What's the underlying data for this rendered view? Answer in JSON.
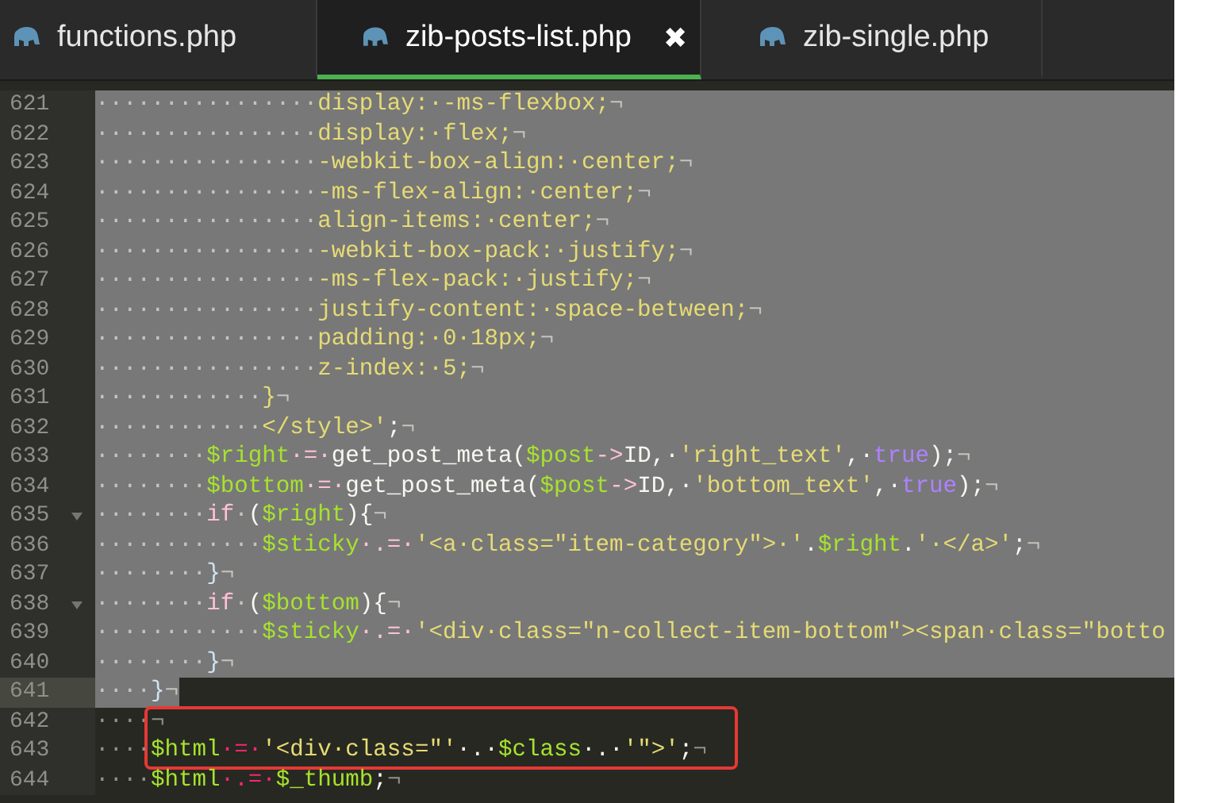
{
  "tabs": [
    {
      "label": "functions.php",
      "selected": false
    },
    {
      "label": "zib-posts-list.php",
      "selected": true,
      "close": "✖"
    },
    {
      "label": "zib-single.php",
      "selected": false
    }
  ],
  "editor": {
    "lines": [
      {
        "number": "621",
        "kind": "selected",
        "fold": false,
        "current": false,
        "segments": [
          {
            "text": "················",
            "kind": "ws"
          },
          {
            "text": "display:·-ms-flexbox;",
            "kind": "str"
          },
          {
            "text": "¬",
            "kind": "ws"
          }
        ]
      },
      {
        "number": "622",
        "kind": "selected",
        "fold": false,
        "current": false,
        "segments": [
          {
            "text": "················",
            "kind": "ws"
          },
          {
            "text": "display:·flex;",
            "kind": "str"
          },
          {
            "text": "¬",
            "kind": "ws"
          }
        ]
      },
      {
        "number": "623",
        "kind": "selected",
        "fold": false,
        "current": false,
        "segments": [
          {
            "text": "················",
            "kind": "ws"
          },
          {
            "text": "-webkit-box-align:·center;",
            "kind": "str"
          },
          {
            "text": "¬",
            "kind": "ws"
          }
        ]
      },
      {
        "number": "624",
        "kind": "selected",
        "fold": false,
        "current": false,
        "segments": [
          {
            "text": "················",
            "kind": "ws"
          },
          {
            "text": "-ms-flex-align:·center;",
            "kind": "str"
          },
          {
            "text": "¬",
            "kind": "ws"
          }
        ]
      },
      {
        "number": "625",
        "kind": "selected",
        "fold": false,
        "current": false,
        "segments": [
          {
            "text": "················",
            "kind": "ws"
          },
          {
            "text": "align-items:·center;",
            "kind": "str"
          },
          {
            "text": "¬",
            "kind": "ws"
          }
        ]
      },
      {
        "number": "626",
        "kind": "selected",
        "fold": false,
        "current": false,
        "segments": [
          {
            "text": "················",
            "kind": "ws"
          },
          {
            "text": "-webkit-box-pack:·justify;",
            "kind": "str"
          },
          {
            "text": "¬",
            "kind": "ws"
          }
        ]
      },
      {
        "number": "627",
        "kind": "selected",
        "fold": false,
        "current": false,
        "segments": [
          {
            "text": "················",
            "kind": "ws"
          },
          {
            "text": "-ms-flex-pack:·justify;",
            "kind": "str"
          },
          {
            "text": "¬",
            "kind": "ws"
          }
        ]
      },
      {
        "number": "628",
        "kind": "selected",
        "fold": false,
        "current": false,
        "segments": [
          {
            "text": "················",
            "kind": "ws"
          },
          {
            "text": "justify-content:·space-between;",
            "kind": "str"
          },
          {
            "text": "¬",
            "kind": "ws"
          }
        ]
      },
      {
        "number": "629",
        "kind": "selected",
        "fold": false,
        "current": false,
        "segments": [
          {
            "text": "················",
            "kind": "ws"
          },
          {
            "text": "padding:·0·18px;",
            "kind": "str"
          },
          {
            "text": "¬",
            "kind": "ws"
          }
        ]
      },
      {
        "number": "630",
        "kind": "selected",
        "fold": false,
        "current": false,
        "segments": [
          {
            "text": "················",
            "kind": "ws"
          },
          {
            "text": "z-index:·5;",
            "kind": "str"
          },
          {
            "text": "¬",
            "kind": "ws"
          }
        ]
      },
      {
        "number": "631",
        "kind": "selected",
        "fold": false,
        "current": false,
        "segments": [
          {
            "text": "············",
            "kind": "ws"
          },
          {
            "text": "}",
            "kind": "str"
          },
          {
            "text": "¬",
            "kind": "ws"
          }
        ]
      },
      {
        "number": "632",
        "kind": "selected",
        "fold": false,
        "current": false,
        "segments": [
          {
            "text": "············",
            "kind": "ws"
          },
          {
            "text": "</style>'",
            "kind": "str"
          },
          {
            "text": ";",
            "kind": "plain"
          },
          {
            "text": "¬",
            "kind": "ws"
          }
        ]
      },
      {
        "number": "633",
        "kind": "selected",
        "fold": false,
        "current": false,
        "segments": [
          {
            "text": "········",
            "kind": "ws"
          },
          {
            "text": "$right",
            "kind": "var"
          },
          {
            "text": "·=·",
            "kind": "op"
          },
          {
            "text": "get_post_meta(",
            "kind": "plain"
          },
          {
            "text": "$post",
            "kind": "var"
          },
          {
            "text": "->",
            "kind": "op"
          },
          {
            "text": "ID,·",
            "kind": "plain"
          },
          {
            "text": "'right_text'",
            "kind": "str"
          },
          {
            "text": ",·",
            "kind": "plain"
          },
          {
            "text": "true",
            "kind": "const"
          },
          {
            "text": ");",
            "kind": "plain"
          },
          {
            "text": "¬",
            "kind": "ws"
          }
        ]
      },
      {
        "number": "634",
        "kind": "selected",
        "fold": false,
        "current": false,
        "segments": [
          {
            "text": "········",
            "kind": "ws"
          },
          {
            "text": "$bottom",
            "kind": "var"
          },
          {
            "text": "·=·",
            "kind": "op"
          },
          {
            "text": "get_post_meta(",
            "kind": "plain"
          },
          {
            "text": "$post",
            "kind": "var"
          },
          {
            "text": "->",
            "kind": "op"
          },
          {
            "text": "ID,·",
            "kind": "plain"
          },
          {
            "text": "'bottom_text'",
            "kind": "str"
          },
          {
            "text": ",·",
            "kind": "plain"
          },
          {
            "text": "true",
            "kind": "const"
          },
          {
            "text": ");",
            "kind": "plain"
          },
          {
            "text": "¬",
            "kind": "ws"
          }
        ]
      },
      {
        "number": "635",
        "kind": "selected",
        "fold": true,
        "current": false,
        "segments": [
          {
            "text": "········",
            "kind": "ws"
          },
          {
            "text": "if",
            "kind": "op"
          },
          {
            "text": "·",
            "kind": "ws"
          },
          {
            "text": "(",
            "kind": "plain"
          },
          {
            "text": "$right",
            "kind": "var"
          },
          {
            "text": "){",
            "kind": "plain"
          },
          {
            "text": "¬",
            "kind": "ws"
          }
        ]
      },
      {
        "number": "636",
        "kind": "selected",
        "fold": false,
        "current": false,
        "segments": [
          {
            "text": "············",
            "kind": "ws"
          },
          {
            "text": "$sticky",
            "kind": "var"
          },
          {
            "text": "·.=·",
            "kind": "op"
          },
          {
            "text": "'<a·class=\"item-category\">·'",
            "kind": "str"
          },
          {
            "text": ".",
            "kind": "plain"
          },
          {
            "text": "$right",
            "kind": "var"
          },
          {
            "text": ".",
            "kind": "plain"
          },
          {
            "text": "'·</a>'",
            "kind": "str"
          },
          {
            "text": ";",
            "kind": "plain"
          },
          {
            "text": "¬",
            "kind": "ws"
          }
        ]
      },
      {
        "number": "637",
        "kind": "selected",
        "fold": false,
        "current": false,
        "segments": [
          {
            "text": "········",
            "kind": "ws"
          },
          {
            "text": "}",
            "kind": "brace"
          },
          {
            "text": "¬",
            "kind": "ws"
          }
        ]
      },
      {
        "number": "638",
        "kind": "selected",
        "fold": true,
        "current": false,
        "segments": [
          {
            "text": "········",
            "kind": "ws"
          },
          {
            "text": "if",
            "kind": "op"
          },
          {
            "text": "·",
            "kind": "ws"
          },
          {
            "text": "(",
            "kind": "plain"
          },
          {
            "text": "$bottom",
            "kind": "var"
          },
          {
            "text": "){",
            "kind": "plain"
          },
          {
            "text": "¬",
            "kind": "ws"
          }
        ]
      },
      {
        "number": "639",
        "kind": "selected",
        "fold": false,
        "current": false,
        "segments": [
          {
            "text": "············",
            "kind": "ws"
          },
          {
            "text": "$sticky",
            "kind": "var"
          },
          {
            "text": "·.=·",
            "kind": "op"
          },
          {
            "text": "'<div·class=\"n-collect-item-bottom\"><span·class=\"botto",
            "kind": "str"
          }
        ]
      },
      {
        "number": "640",
        "kind": "selected",
        "fold": false,
        "current": false,
        "segments": [
          {
            "text": "········",
            "kind": "ws"
          },
          {
            "text": "}",
            "kind": "brace"
          },
          {
            "text": "¬",
            "kind": "ws"
          }
        ]
      },
      {
        "number": "641",
        "kind": "partial",
        "fold": false,
        "current": true,
        "segments": [
          {
            "text": "····",
            "kind": "ws"
          },
          {
            "text": "}",
            "kind": "brace"
          },
          {
            "text": "¬",
            "kind": "ws"
          }
        ]
      },
      {
        "number": "642",
        "kind": "plain",
        "fold": false,
        "current": false,
        "boxed": true,
        "segments": [
          {
            "text": "····¬",
            "kind": "ws"
          }
        ]
      },
      {
        "number": "643",
        "kind": "plain",
        "fold": false,
        "current": false,
        "boxed": true,
        "segments": [
          {
            "text": "····",
            "kind": "ws"
          },
          {
            "text": "$html",
            "kind": "var"
          },
          {
            "text": "·=·",
            "kind": "op"
          },
          {
            "text": "'<div·class=\"'",
            "kind": "str"
          },
          {
            "text": "·.·",
            "kind": "plain"
          },
          {
            "text": "$class",
            "kind": "var"
          },
          {
            "text": "·.·",
            "kind": "plain"
          },
          {
            "text": "'\">'",
            "kind": "str"
          },
          {
            "text": ";",
            "kind": "plain"
          },
          {
            "text": "¬",
            "kind": "ws"
          }
        ]
      },
      {
        "number": "644",
        "kind": "plain",
        "fold": false,
        "current": false,
        "boxed": false,
        "segments": [
          {
            "text": "····",
            "kind": "ws"
          },
          {
            "text": "$html",
            "kind": "var"
          },
          {
            "text": "·.=·",
            "kind": "op"
          },
          {
            "text": "$_thumb",
            "kind": "var"
          },
          {
            "text": ";",
            "kind": "plain"
          },
          {
            "text": "¬",
            "kind": "ws"
          }
        ]
      }
    ]
  }
}
